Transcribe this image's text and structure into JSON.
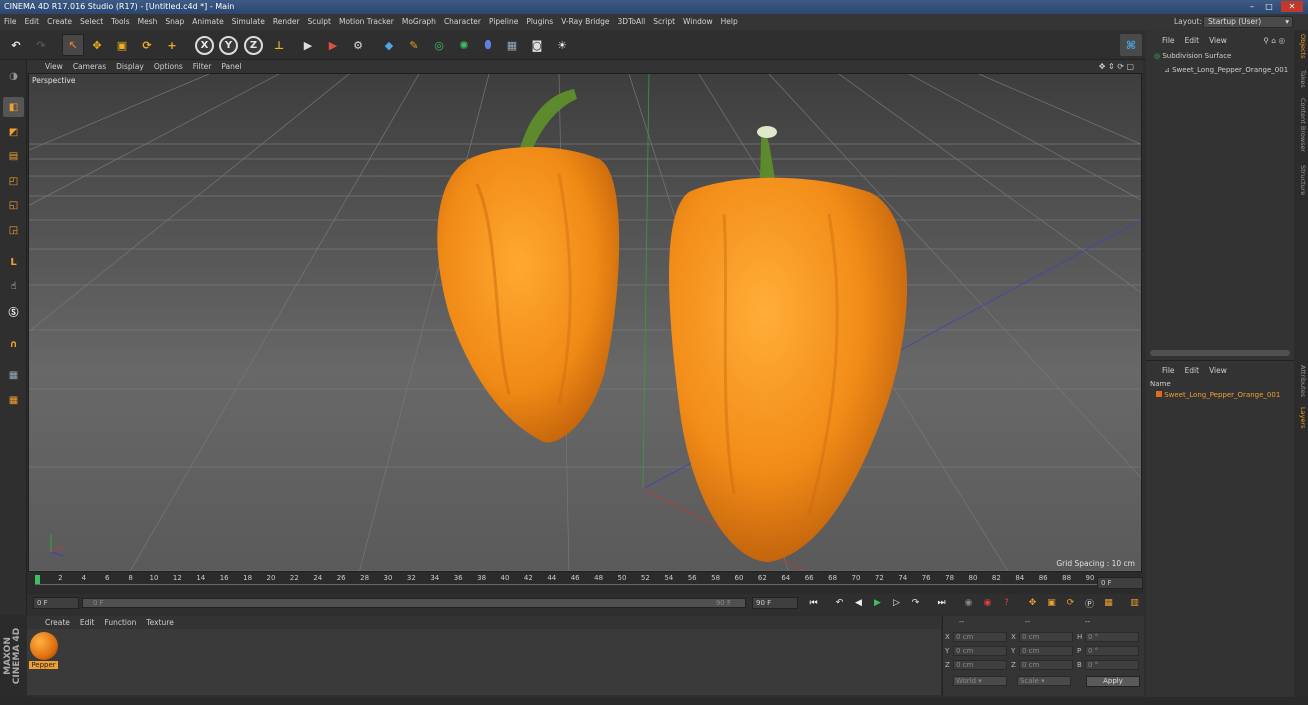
{
  "window": {
    "title": "CINEMA 4D R17.016 Studio (R17) - [Untitled.c4d *] - Main"
  },
  "menu": [
    "File",
    "Edit",
    "Create",
    "Select",
    "Tools",
    "Mesh",
    "Snap",
    "Animate",
    "Simulate",
    "Render",
    "Sculpt",
    "Motion Tracker",
    "MoGraph",
    "Character",
    "Pipeline",
    "Plugins",
    "V-Ray Bridge",
    "3DToAll",
    "Script",
    "Window",
    "Help"
  ],
  "layout": {
    "label": "Layout:",
    "value": "Startup (User)"
  },
  "toolbar": {
    "axis_x": "X",
    "axis_y": "Y",
    "axis_z": "Z"
  },
  "viewport": {
    "menu": [
      "View",
      "Cameras",
      "Display",
      "Options",
      "Filter",
      "Panel"
    ],
    "label": "Perspective",
    "grid_spacing": "Grid Spacing : 10 cm"
  },
  "timeline": {
    "ticks": [
      "0",
      "2",
      "4",
      "6",
      "8",
      "10",
      "12",
      "14",
      "16",
      "18",
      "20",
      "22",
      "24",
      "26",
      "28",
      "30",
      "32",
      "34",
      "36",
      "38",
      "40",
      "42",
      "44",
      "46",
      "48",
      "50",
      "52",
      "54",
      "56",
      "58",
      "60",
      "62",
      "64",
      "66",
      "68",
      "70",
      "72",
      "74",
      "76",
      "78",
      "80",
      "82",
      "84",
      "86",
      "88",
      "90"
    ],
    "current_frame": "0 F",
    "start_frame": "0 F",
    "slider_start": "0 F",
    "slider_end": "90 F",
    "end_frame": "90 F"
  },
  "materials": {
    "menu": [
      "Create",
      "Edit",
      "Function",
      "Texture"
    ],
    "items": [
      {
        "name": "Pepper"
      }
    ]
  },
  "coordinates": {
    "header": [
      "--",
      "--",
      "--"
    ],
    "rows": [
      {
        "a": "X",
        "av": "0 cm",
        "b": "X",
        "bv": "0 cm",
        "c": "H",
        "cv": "0 °"
      },
      {
        "a": "Y",
        "av": "0 cm",
        "b": "Y",
        "bv": "0 cm",
        "c": "P",
        "cv": "0 °"
      },
      {
        "a": "Z",
        "av": "0 cm",
        "b": "Z",
        "bv": "0 cm",
        "c": "B",
        "cv": "0 °"
      }
    ],
    "mode": "World",
    "type": "Scale",
    "apply": "Apply"
  },
  "objects": {
    "menu": [
      "File",
      "Edit",
      "View"
    ],
    "items": [
      "Subdivision Surface",
      "Sweet_Long_Pepper_Orange_001"
    ]
  },
  "attributes": {
    "menu": [
      "File",
      "Edit",
      "View"
    ],
    "column": "Name",
    "items": [
      "Sweet_Long_Pepper_Orange_001"
    ]
  },
  "side_tabs": [
    "Objects",
    "Takes",
    "Content Browser",
    "Structure",
    "Attributes",
    "Layers"
  ],
  "branding": {
    "logo": "MAXON CINEMA 4D"
  }
}
